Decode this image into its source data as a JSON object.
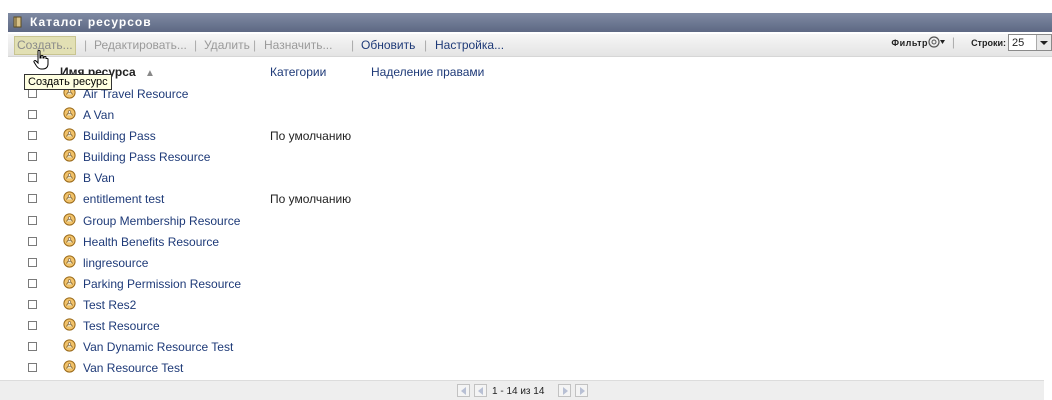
{
  "window": {
    "title": "Каталог ресурсов"
  },
  "toolbar": {
    "create": "Создать...",
    "edit": "Редактировать...",
    "delete": "Удалить",
    "assign": "Назначить...",
    "refresh": "Обновить",
    "settings": "Настройка...",
    "filter_label": "Фильтр",
    "rows_label": "Строки:",
    "rows_value": "25"
  },
  "tooltip": "Создать ресурс",
  "table": {
    "headers": {
      "name": "Имя ресурса",
      "sort_indicator": "▲",
      "categories": "Категории",
      "entitlements": "Наделение правами"
    },
    "rows": [
      {
        "name": "Air Travel Resource",
        "category": ""
      },
      {
        "name": "A Van",
        "category": ""
      },
      {
        "name": "Building Pass",
        "category": "По умолчанию"
      },
      {
        "name": "Building Pass Resource",
        "category": ""
      },
      {
        "name": "B Van",
        "category": ""
      },
      {
        "name": "entitlement test",
        "category": "По умолчанию"
      },
      {
        "name": "Group Membership Resource",
        "category": ""
      },
      {
        "name": "Health Benefits Resource",
        "category": ""
      },
      {
        "name": "lingresource",
        "category": ""
      },
      {
        "name": "Parking Permission Resource",
        "category": ""
      },
      {
        "name": "Test Res2",
        "category": ""
      },
      {
        "name": "Test Resource",
        "category": ""
      },
      {
        "name": "Van Dynamic Resource Test",
        "category": ""
      },
      {
        "name": "Van Resource Test",
        "category": ""
      }
    ]
  },
  "pager": {
    "info": "1 - 14 из 14"
  },
  "colors": {
    "titlebar": "#6b7590",
    "link": "#1e3a78",
    "disabled": "#9a9a9a"
  }
}
